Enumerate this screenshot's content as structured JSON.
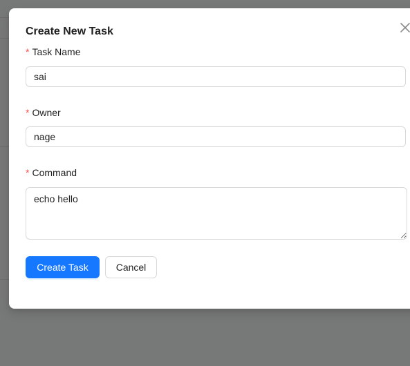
{
  "modal": {
    "title": "Create New Task",
    "close_icon": "close-icon"
  },
  "form": {
    "required_mark": "*",
    "task_name": {
      "label": "Task Name",
      "value": "sai"
    },
    "owner": {
      "label": "Owner",
      "value": "nage"
    },
    "command": {
      "label": "Command",
      "value": "echo hello"
    }
  },
  "actions": {
    "create_label": "Create Task",
    "cancel_label": "Cancel"
  },
  "colors": {
    "primary": "#1677ff",
    "required": "#ff4d4f",
    "overlay": "#777878"
  }
}
